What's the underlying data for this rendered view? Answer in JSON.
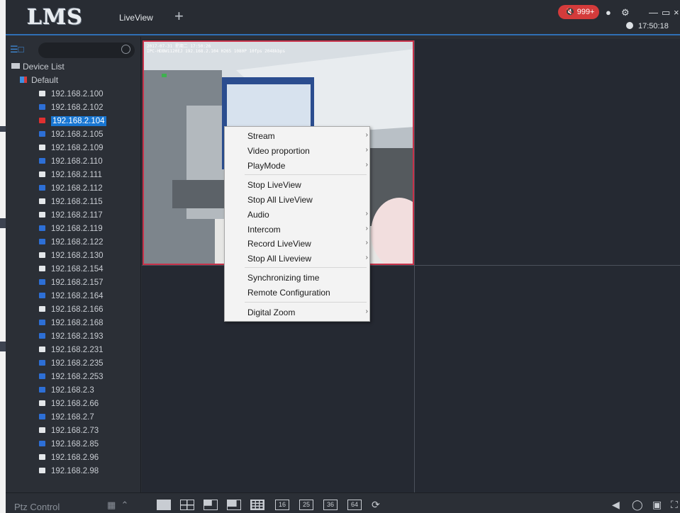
{
  "app": {
    "logo": "LMS"
  },
  "tabs": {
    "liveview": "LiveView",
    "add": "+"
  },
  "topbar": {
    "alarm_count": "999+",
    "time": "17:50:18",
    "user_icon": "user-icon",
    "settings_icon": "gear-icon",
    "minimize": "—",
    "restore": "▭",
    "close": "×"
  },
  "sidebar": {
    "root_label": "Device List",
    "group_label": "Default",
    "selected_ip": "192.168.2.104",
    "devices": [
      {
        "ip": "192.168.2.100",
        "color": "white"
      },
      {
        "ip": "192.168.2.102",
        "color": "blue"
      },
      {
        "ip": "192.168.2.104",
        "color": "red"
      },
      {
        "ip": "192.168.2.105",
        "color": "blue"
      },
      {
        "ip": "192.168.2.109",
        "color": "white"
      },
      {
        "ip": "192.168.2.110",
        "color": "blue"
      },
      {
        "ip": "192.168.2.111",
        "color": "white"
      },
      {
        "ip": "192.168.2.112",
        "color": "blue"
      },
      {
        "ip": "192.168.2.115",
        "color": "white"
      },
      {
        "ip": "192.168.2.117",
        "color": "white"
      },
      {
        "ip": "192.168.2.119",
        "color": "blue"
      },
      {
        "ip": "192.168.2.122",
        "color": "blue"
      },
      {
        "ip": "192.168.2.130",
        "color": "white"
      },
      {
        "ip": "192.168.2.154",
        "color": "white"
      },
      {
        "ip": "192.168.2.157",
        "color": "blue"
      },
      {
        "ip": "192.168.2.164",
        "color": "blue"
      },
      {
        "ip": "192.168.2.166",
        "color": "white"
      },
      {
        "ip": "192.168.2.168",
        "color": "blue"
      },
      {
        "ip": "192.168.2.193",
        "color": "blue"
      },
      {
        "ip": "192.168.2.231",
        "color": "white"
      },
      {
        "ip": "192.168.2.235",
        "color": "blue"
      },
      {
        "ip": "192.168.2.253",
        "color": "blue"
      },
      {
        "ip": "192.168.2.3",
        "color": "blue"
      },
      {
        "ip": "192.168.2.66",
        "color": "white"
      },
      {
        "ip": "192.168.2.7",
        "color": "blue"
      },
      {
        "ip": "192.168.2.73",
        "color": "white"
      },
      {
        "ip": "192.168.2.85",
        "color": "blue"
      },
      {
        "ip": "192.168.2.96",
        "color": "white"
      },
      {
        "ip": "192.168.2.98",
        "color": "white"
      }
    ]
  },
  "video": {
    "osd_line1": "2017-07-31 星期二 17:50:26",
    "osd_line2": "IPC-HDBW1120EJ 192.168.2.104 H265 1080P 10fps 2048kbps"
  },
  "context_menu": {
    "items": [
      {
        "label": "Stream",
        "submenu": true
      },
      {
        "label": "Video proportion",
        "submenu": true
      },
      {
        "label": "PlayMode",
        "submenu": true
      },
      {
        "label": "Stop LiveView",
        "submenu": false
      },
      {
        "label": "Stop All LiveView",
        "submenu": false
      },
      {
        "label": "Audio",
        "submenu": true
      },
      {
        "label": "Intercom",
        "submenu": true
      },
      {
        "label": "Record LiveView",
        "submenu": true
      },
      {
        "label": "Stop All Liveview",
        "submenu": true
      },
      {
        "label": "Synchronizing time",
        "submenu": false
      },
      {
        "label": "Remote Configuration",
        "submenu": false
      },
      {
        "label": "Digital Zoom",
        "submenu": true
      }
    ],
    "arrow": "›"
  },
  "bottombar": {
    "ptz_label": "Ptz Control",
    "layouts": [
      "16",
      "25",
      "36",
      "64"
    ],
    "icons": [
      "speaker-icon",
      "microphone-icon",
      "camera-icon",
      "fullscreen-icon"
    ]
  },
  "colors": {
    "accent": "#2f6fb5",
    "selection": "#1876d2",
    "alarm": "#d43b3b",
    "active_cell_border": "#c8324a"
  }
}
